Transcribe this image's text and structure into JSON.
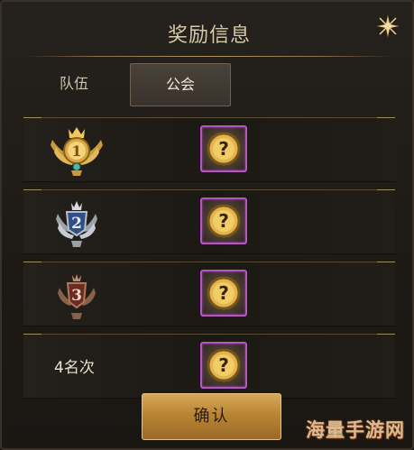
{
  "dialog": {
    "title": "奖励信息",
    "close_icon": "star-close-icon"
  },
  "tabs": [
    {
      "label": "队伍",
      "selected": false
    },
    {
      "label": "公会",
      "selected": true
    }
  ],
  "rows": [
    {
      "rank": 1,
      "medal_icon": "gold-rank-1-medal-icon",
      "reward_icon": "unknown-reward-question-icon"
    },
    {
      "rank": 2,
      "medal_icon": "silver-rank-2-medal-icon",
      "reward_icon": "unknown-reward-question-icon"
    },
    {
      "rank": 3,
      "medal_icon": "bronze-rank-3-medal-icon",
      "reward_icon": "unknown-reward-question-icon"
    },
    {
      "rank_label": "4名次",
      "reward_icon": "unknown-reward-question-icon"
    }
  ],
  "confirm_label": "确认",
  "watermark": "海量手游网",
  "colors": {
    "gold": "#d7a95a",
    "reward_border": "#b656c4",
    "title_text": "#d8c8a6"
  }
}
